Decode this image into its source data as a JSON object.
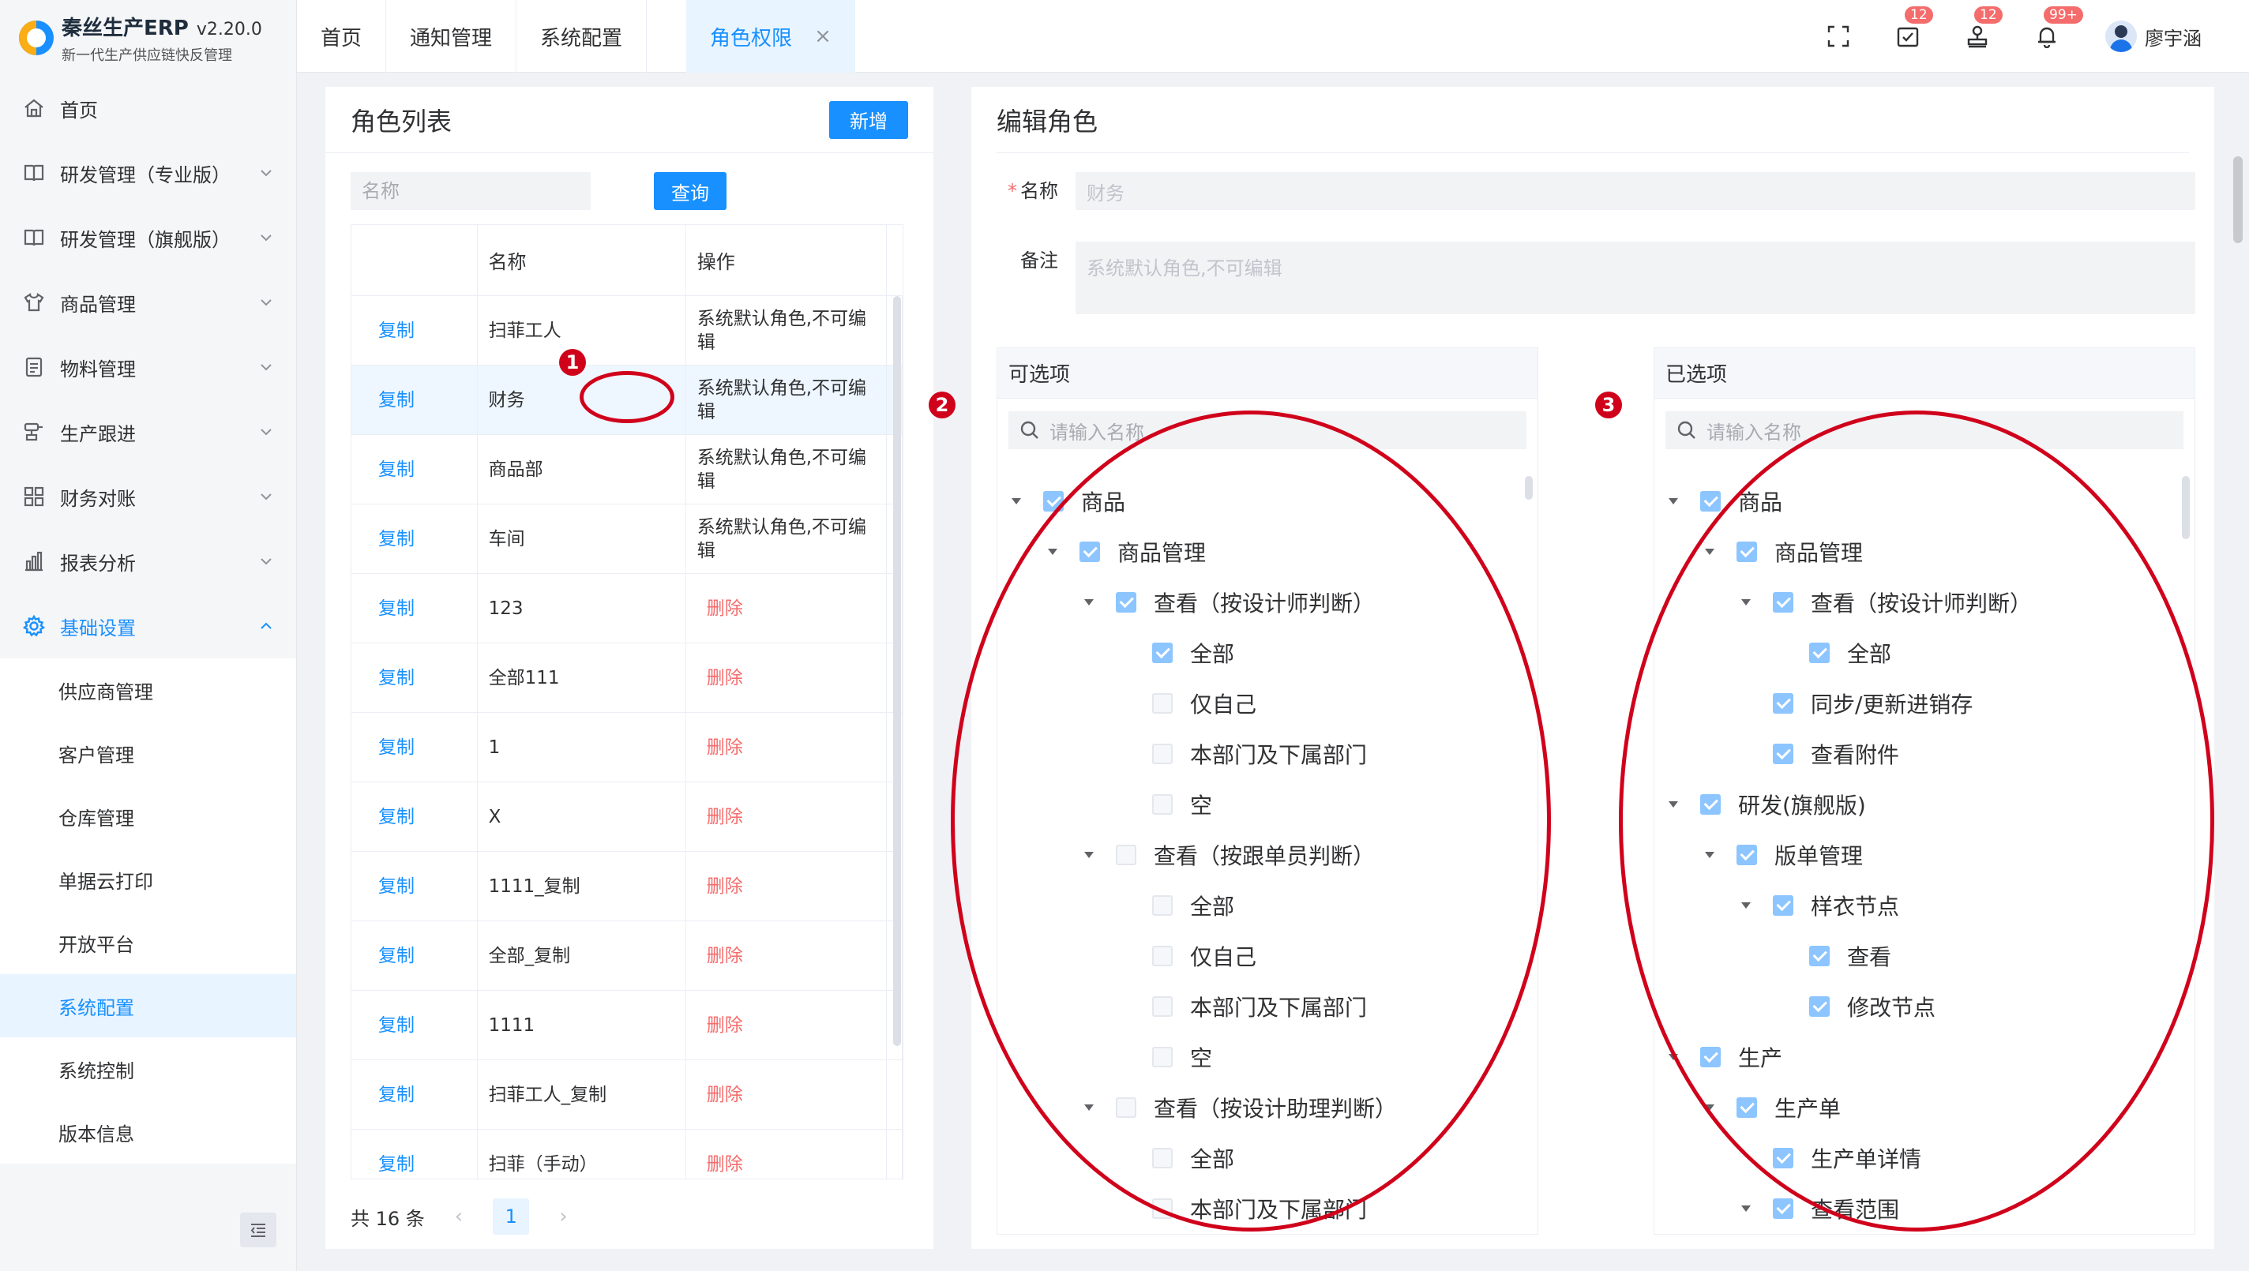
{
  "app": {
    "title": "秦丝生产ERP",
    "version": "v2.20.0",
    "subtitle": "新一代生产供应链快反管理"
  },
  "sidebar": {
    "items": [
      {
        "label": "首页",
        "icon": "home-icon",
        "expandable": false
      },
      {
        "label": "研发管理（专业版）",
        "icon": "book-icon",
        "expandable": true
      },
      {
        "label": "研发管理（旗舰版）",
        "icon": "book-icon",
        "expandable": true
      },
      {
        "label": "商品管理",
        "icon": "shirt-icon",
        "expandable": true
      },
      {
        "label": "物料管理",
        "icon": "document-icon",
        "expandable": true
      },
      {
        "label": "生产跟进",
        "icon": "stamp-icon",
        "expandable": true
      },
      {
        "label": "财务对账",
        "icon": "grid-icon",
        "expandable": true
      },
      {
        "label": "报表分析",
        "icon": "bar-chart-icon",
        "expandable": true
      },
      {
        "label": "基础设置",
        "icon": "gear-icon",
        "expandable": true,
        "expanded": true
      }
    ],
    "subitems": [
      {
        "label": "供应商管理"
      },
      {
        "label": "客户管理"
      },
      {
        "label": "仓库管理"
      },
      {
        "label": "单据云打印"
      },
      {
        "label": "开放平台"
      },
      {
        "label": "系统配置",
        "active": true
      },
      {
        "label": "系统控制"
      },
      {
        "label": "版本信息"
      }
    ]
  },
  "tabs": [
    {
      "label": "首页"
    },
    {
      "label": "通知管理"
    },
    {
      "label": "系统配置"
    },
    {
      "label": "角色权限",
      "active": true
    }
  ],
  "topbar": {
    "task_badge": "12",
    "stamp_badge": "12",
    "bell_badge": "99+",
    "user_name": "廖宇涵"
  },
  "role_list": {
    "title": "角色列表",
    "add_label": "新增",
    "search_placeholder": "名称",
    "query_label": "查询",
    "columns": [
      "名称",
      "操作"
    ],
    "rows": [
      {
        "copy": "复制",
        "name": "扫菲工人",
        "op": "系统默认角色,不可编辑",
        "default": true
      },
      {
        "copy": "复制",
        "name": "财务",
        "op": "系统默认角色,不可编辑",
        "default": true,
        "selected": true
      },
      {
        "copy": "复制",
        "name": "商品部",
        "op": "系统默认角色,不可编辑",
        "default": true
      },
      {
        "copy": "复制",
        "name": "车间",
        "op": "系统默认角色,不可编辑",
        "default": true
      },
      {
        "copy": "复制",
        "name": "123",
        "op": "删除",
        "default": false
      },
      {
        "copy": "复制",
        "name": "全部111",
        "op": "删除",
        "default": false
      },
      {
        "copy": "复制",
        "name": "1",
        "op": "删除",
        "default": false
      },
      {
        "copy": "复制",
        "name": "X",
        "op": "删除",
        "default": false
      },
      {
        "copy": "复制",
        "name": "1111_复制",
        "op": "删除",
        "default": false
      },
      {
        "copy": "复制",
        "name": "全部_复制",
        "op": "删除",
        "default": false
      },
      {
        "copy": "复制",
        "name": "1111",
        "op": "删除",
        "default": false
      },
      {
        "copy": "复制",
        "name": "扫菲工人_复制",
        "op": "删除",
        "default": false
      },
      {
        "copy": "复制",
        "name": "扫菲（手动）",
        "op": "删除",
        "default": false
      }
    ],
    "total_label": "共 16 条",
    "current_page": "1"
  },
  "edit_role": {
    "title": "编辑角色",
    "name_label": "名称",
    "name_value": "财务",
    "remark_label": "备注",
    "remark_value": "系统默认角色,不可编辑",
    "available": {
      "title": "可选项",
      "search_placeholder": "请输入名称",
      "nodes": [
        {
          "label": "商品",
          "level": 0,
          "caret": true,
          "checked": true
        },
        {
          "label": "商品管理",
          "level": 1,
          "caret": true,
          "checked": true
        },
        {
          "label": "查看（按设计师判断）",
          "level": 2,
          "caret": true,
          "checked": true
        },
        {
          "label": "全部",
          "level": 3,
          "caret": false,
          "checked": true
        },
        {
          "label": "仅自己",
          "level": 3,
          "caret": false,
          "checked": false
        },
        {
          "label": "本部门及下属部门",
          "level": 3,
          "caret": false,
          "checked": false
        },
        {
          "label": "空",
          "level": 3,
          "caret": false,
          "checked": false
        },
        {
          "label": "查看（按跟单员判断）",
          "level": 2,
          "caret": true,
          "checked": false
        },
        {
          "label": "全部",
          "level": 3,
          "caret": false,
          "checked": false
        },
        {
          "label": "仅自己",
          "level": 3,
          "caret": false,
          "checked": false
        },
        {
          "label": "本部门及下属部门",
          "level": 3,
          "caret": false,
          "checked": false
        },
        {
          "label": "空",
          "level": 3,
          "caret": false,
          "checked": false
        },
        {
          "label": "查看（按设计助理判断）",
          "level": 2,
          "caret": true,
          "checked": false
        },
        {
          "label": "全部",
          "level": 3,
          "caret": false,
          "checked": false
        },
        {
          "label": "本部门及下属部门",
          "level": 3,
          "caret": false,
          "checked": false
        }
      ]
    },
    "selected": {
      "title": "已选项",
      "search_placeholder": "请输入名称",
      "nodes": [
        {
          "label": "商品",
          "level": 0,
          "caret": true,
          "checked": true
        },
        {
          "label": "商品管理",
          "level": 1,
          "caret": true,
          "checked": true
        },
        {
          "label": "查看（按设计师判断）",
          "level": 2,
          "caret": true,
          "checked": true
        },
        {
          "label": "全部",
          "level": 3,
          "caret": false,
          "checked": true
        },
        {
          "label": "同步/更新进销存",
          "level": 2,
          "caret": false,
          "checked": true
        },
        {
          "label": "查看附件",
          "level": 2,
          "caret": false,
          "checked": true
        },
        {
          "label": "研发(旗舰版)",
          "level": 0,
          "caret": true,
          "checked": true
        },
        {
          "label": "版单管理",
          "level": 1,
          "caret": true,
          "checked": true
        },
        {
          "label": "样衣节点",
          "level": 2,
          "caret": true,
          "checked": true
        },
        {
          "label": "查看",
          "level": 3,
          "caret": false,
          "checked": true
        },
        {
          "label": "修改节点",
          "level": 3,
          "caret": false,
          "checked": true
        },
        {
          "label": "生产",
          "level": 0,
          "caret": true,
          "checked": true
        },
        {
          "label": "生产单",
          "level": 1,
          "caret": true,
          "checked": true
        },
        {
          "label": "生产单详情",
          "level": 2,
          "caret": false,
          "checked": true
        },
        {
          "label": "查看范围",
          "level": 2,
          "caret": true,
          "checked": true
        }
      ]
    }
  },
  "annotations": {
    "marker_1": "1",
    "marker_2": "2",
    "marker_3": "3",
    "color": "#d0021b"
  },
  "colors": {
    "primary": "#1890ff",
    "danger": "#f56c6c",
    "checkbox_checked": "#8cc5ff"
  }
}
